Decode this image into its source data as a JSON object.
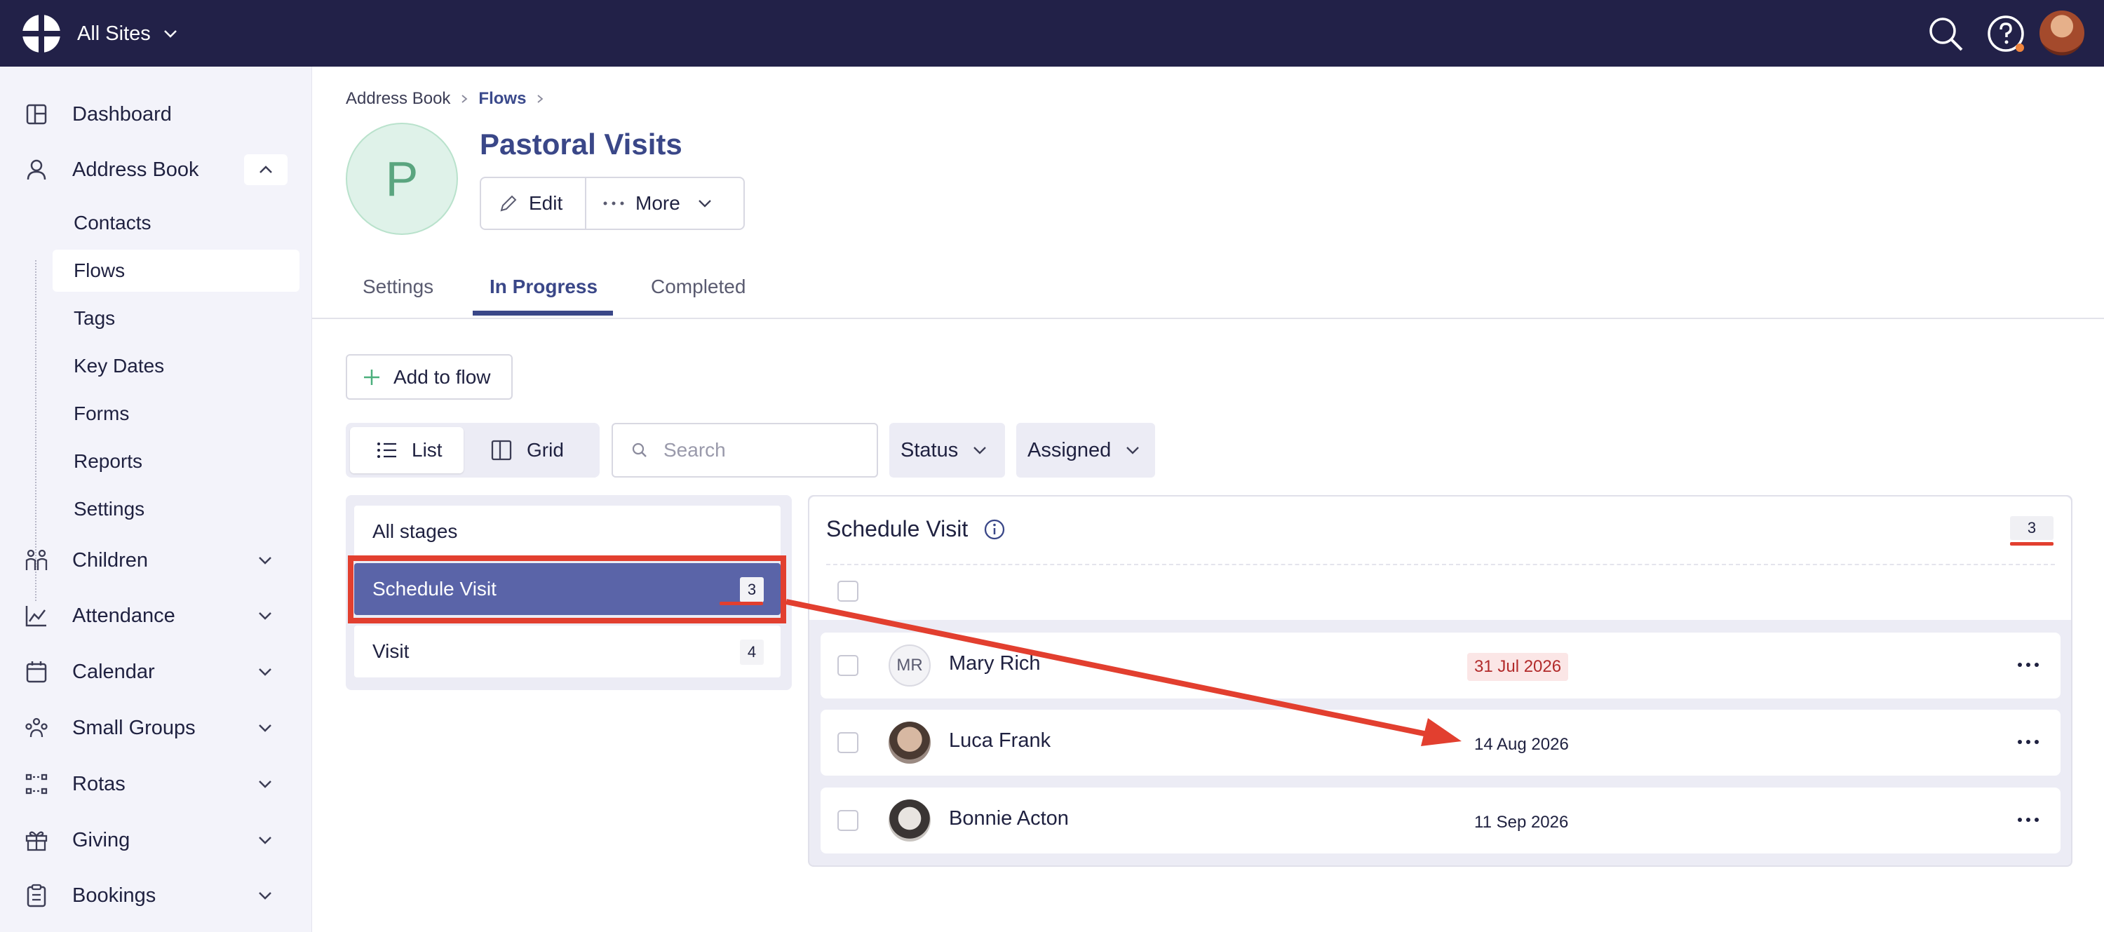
{
  "topbar": {
    "site_switcher": "All Sites",
    "logo_icon": "church-logo-icon",
    "search_icon": "search-icon",
    "help_icon": "help-icon",
    "avatar": "user-avatar"
  },
  "sidebar": {
    "items": [
      {
        "label": "Dashboard",
        "icon": "dashboard-icon"
      },
      {
        "label": "Address Book",
        "icon": "person-icon"
      },
      {
        "label": "Children",
        "icon": "children-icon"
      },
      {
        "label": "Attendance",
        "icon": "chart-icon"
      },
      {
        "label": "Calendar",
        "icon": "calendar-icon"
      },
      {
        "label": "Small Groups",
        "icon": "group-icon"
      },
      {
        "label": "Rotas",
        "icon": "rota-icon"
      },
      {
        "label": "Giving",
        "icon": "gift-icon"
      },
      {
        "label": "Bookings",
        "icon": "clipboard-icon"
      }
    ],
    "address_book_sub": [
      "Contacts",
      "Flows",
      "Tags",
      "Key Dates",
      "Forms",
      "Reports",
      "Settings"
    ],
    "active_sub": "Flows"
  },
  "breadcrumb": {
    "root": "Address Book",
    "current": "Flows"
  },
  "flow": {
    "initial": "P",
    "title": "Pastoral Visits",
    "edit_label": "Edit",
    "more_label": "More"
  },
  "tabs": [
    "Settings",
    "In Progress",
    "Completed"
  ],
  "active_tab": "In Progress",
  "add_button": "Add to flow",
  "view": {
    "list": "List",
    "grid": "Grid",
    "active": "List"
  },
  "search": {
    "placeholder": "Search",
    "value": ""
  },
  "filters": {
    "status": "Status",
    "assigned": "Assigned"
  },
  "stages": [
    {
      "label": "All stages",
      "count": ""
    },
    {
      "label": "Schedule Visit",
      "count": "3"
    },
    {
      "label": "Visit",
      "count": "4"
    }
  ],
  "active_stage": "Schedule Visit",
  "list": {
    "title": "Schedule Visit",
    "count": "3",
    "rows": [
      {
        "initials": "MR",
        "name": "Mary Rich",
        "date": "31 Jul 2026",
        "overdue": true
      },
      {
        "initials": "",
        "name": "Luca Frank",
        "date": "14 Aug 2026",
        "overdue": false
      },
      {
        "initials": "",
        "name": "Bonnie Acton",
        "date": "11 Sep 2026",
        "overdue": false
      }
    ]
  },
  "annotation_color": "#e23f2f",
  "accent_color": "#3a4788",
  "topbar_color": "#222148"
}
